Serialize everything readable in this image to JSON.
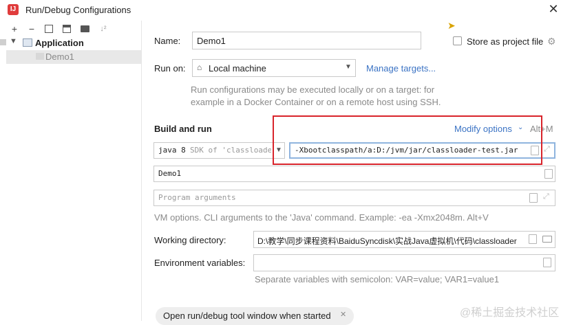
{
  "window": {
    "title": "Run/Debug Configurations"
  },
  "toolbar": {
    "add": "+",
    "remove": "−",
    "sort": "↓²"
  },
  "tree": {
    "group_label": "Application",
    "item_label": "Demo1"
  },
  "form": {
    "name_label": "Name:",
    "name_value": "Demo1",
    "store_label": "Store as project file",
    "run_on_label": "Run on:",
    "run_on_value": "Local machine",
    "manage_targets": "Manage targets...",
    "run_on_hint_1": "Run configurations may be executed locally or on a target: for",
    "run_on_hint_2": "example in a Docker Container or on a remote host using SSH.",
    "build_run_label": "Build and run",
    "modify_options": "Modify options",
    "modify_shortcut": "Alt+M",
    "sdk_java": "java 8",
    "sdk_hint": "SDK of 'classloader",
    "vm_options_value": "-Xbootclasspath/a:D:/jvm/jar/classloader-test.jar",
    "main_class_value": "Demo1",
    "program_args_placeholder": "Program arguments",
    "vm_hint": "VM options. CLI arguments to the 'Java' command. Example: -ea -Xmx2048m. Alt+V",
    "working_dir_label": "Working directory:",
    "working_dir_value": "D:\\教学\\同步课程资料\\BaiduSyncdisk\\实战Java虚拟机\\代码\\classloader",
    "env_label": "Environment variables:",
    "env_hint": "Separate variables with semicolon: VAR=value; VAR1=value1",
    "open_tool_window": "Open run/debug tool window when started"
  },
  "watermark": "@稀土掘金技术社区",
  "colors": {
    "accent_link": "#3b73c4",
    "highlight_border": "#d8232a"
  }
}
